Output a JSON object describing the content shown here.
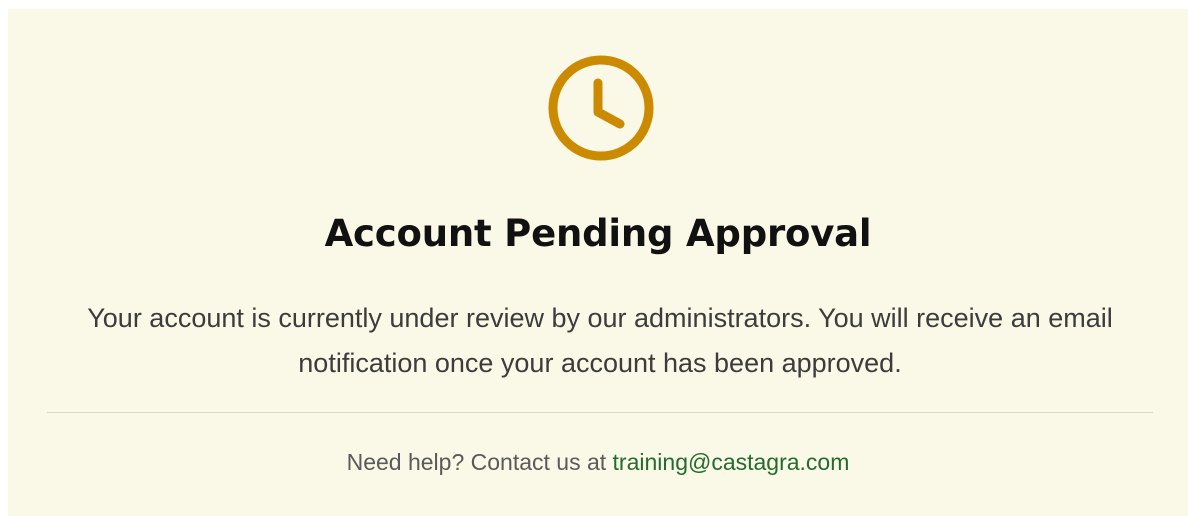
{
  "status": {
    "icon": "clock-icon",
    "icon_color": "#cc8a00",
    "title": "Account Pending Approval",
    "message": "Your account is currently under review by our administrators. You will receive an email notification once your account has been approved."
  },
  "help": {
    "prefix": "Need help? Contact us at",
    "email": "training@castagra.com",
    "link_color": "#236b2e"
  },
  "theme": {
    "card_background": "#faf8e6"
  }
}
